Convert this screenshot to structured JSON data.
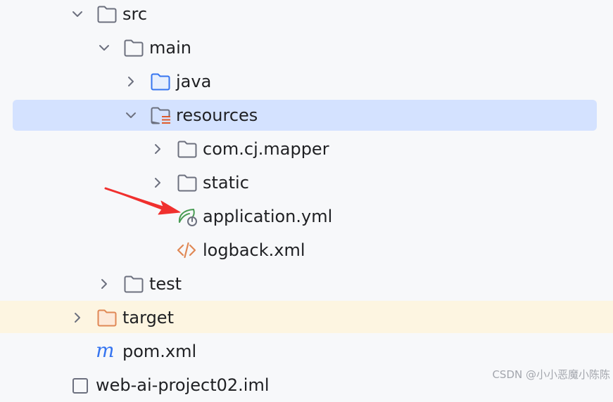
{
  "tree": {
    "items": [
      {
        "label": "src",
        "icon": "folder-icon",
        "expanded": true
      },
      {
        "label": "main",
        "icon": "folder-icon",
        "expanded": true
      },
      {
        "label": "java",
        "icon": "source-folder-icon",
        "expanded": false
      },
      {
        "label": "resources",
        "icon": "resources-folder-icon",
        "expanded": true,
        "selected": true
      },
      {
        "label": "com.cj.mapper",
        "icon": "folder-icon",
        "expanded": false
      },
      {
        "label": "static",
        "icon": "folder-icon",
        "expanded": false
      },
      {
        "label": "application.yml",
        "icon": "spring-config-icon"
      },
      {
        "label": "logback.xml",
        "icon": "xml-file-icon"
      },
      {
        "label": "test",
        "icon": "folder-icon",
        "expanded": false
      },
      {
        "label": "target",
        "icon": "excluded-folder-icon",
        "expanded": false,
        "excluded": true
      },
      {
        "label": "pom.xml",
        "icon": "maven-icon"
      },
      {
        "label": "web-ai-project02.iml",
        "icon": "module-file-icon"
      }
    ]
  },
  "annotation": {
    "arrow": "red-arrow-icon",
    "color": "#f0302e"
  },
  "watermark": "CSDN @小小恶魔小陈陈",
  "colors": {
    "selection": "#d4e2ff",
    "excluded_row": "#fdf5e1",
    "folder_stroke": "#6c707e",
    "source_folder_stroke": "#3574f0",
    "excluded_folder_stroke": "#e08855",
    "spring_green": "#499c54",
    "xml_orange": "#e08855",
    "maven_blue": "#3574f0"
  }
}
